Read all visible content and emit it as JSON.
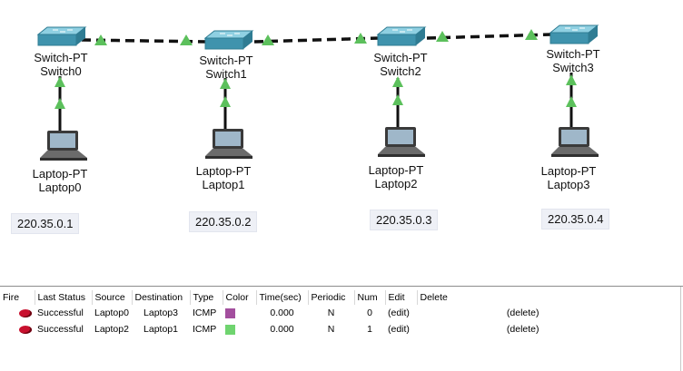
{
  "topology": {
    "switches": [
      {
        "type": "Switch-PT",
        "name": "Switch0"
      },
      {
        "type": "Switch-PT",
        "name": "Switch1"
      },
      {
        "type": "Switch-PT",
        "name": "Switch2"
      },
      {
        "type": "Switch-PT",
        "name": "Switch3"
      }
    ],
    "laptops": [
      {
        "type": "Laptop-PT",
        "name": "Laptop0",
        "ip": "220.35.0.1"
      },
      {
        "type": "Laptop-PT",
        "name": "Laptop1",
        "ip": "220.35.0.2"
      },
      {
        "type": "Laptop-PT",
        "name": "Laptop2",
        "ip": "220.35.0.3"
      },
      {
        "type": "Laptop-PT",
        "name": "Laptop3",
        "ip": "220.35.0.4"
      }
    ],
    "colors": {
      "switch": "#4a9fb8",
      "link_up": "#5cc05c",
      "cable": "#111111"
    }
  },
  "pdu_table": {
    "headers": [
      "Fire",
      "Last Status",
      "Source",
      "Destination",
      "Type",
      "Color",
      "Time(sec)",
      "Periodic",
      "Num",
      "Edit",
      "Delete"
    ],
    "rows": [
      {
        "status": "Successful",
        "source": "Laptop0",
        "destination": "Laptop3",
        "type": "ICMP",
        "color": "#a34f9e",
        "time": "0.000",
        "periodic": "N",
        "num": "0",
        "edit": "(edit)",
        "delete": "(delete)"
      },
      {
        "status": "Successful",
        "source": "Laptop2",
        "destination": "Laptop1",
        "type": "ICMP",
        "color": "#6fd46f",
        "time": "0.000",
        "periodic": "N",
        "num": "1",
        "edit": "(edit)",
        "delete": "(delete)"
      }
    ]
  }
}
